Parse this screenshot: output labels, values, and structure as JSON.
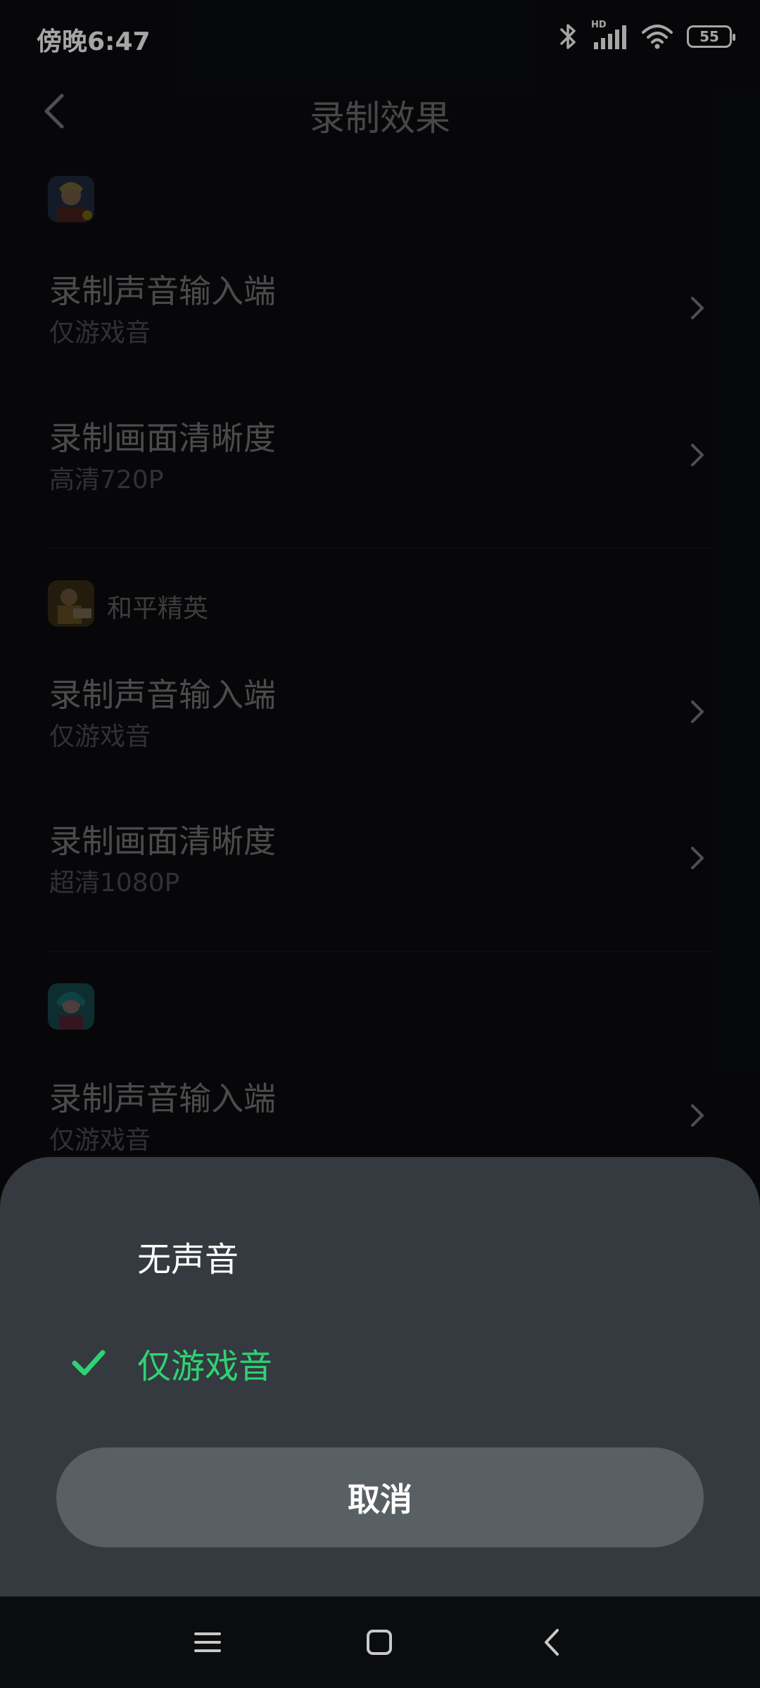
{
  "status_bar": {
    "time": "傍晚6:47",
    "network_label": "HD",
    "battery": "55"
  },
  "header": {
    "title": "录制效果"
  },
  "sections": [
    {
      "game_name": "",
      "icon": "game-icon-warrior",
      "rows": [
        {
          "title": "录制声音输入端",
          "value": "仅游戏音"
        },
        {
          "title": "录制画面清晰度",
          "value": "高清720P"
        }
      ]
    },
    {
      "game_name": "和平精英",
      "icon": "game-icon-peace-elite",
      "rows": [
        {
          "title": "录制声音输入端",
          "value": "仅游戏音"
        },
        {
          "title": "录制画面清晰度",
          "value": "超清1080P"
        }
      ]
    },
    {
      "game_name": "",
      "icon": "game-icon-teal-hero",
      "rows": [
        {
          "title": "录制声音输入端",
          "value": "仅游戏音"
        }
      ]
    }
  ],
  "sheet": {
    "options": [
      {
        "label": "无声音",
        "selected": false
      },
      {
        "label": "仅游戏音",
        "selected": true
      }
    ],
    "cancel_label": "取消"
  },
  "colors": {
    "accent": "#2fd274",
    "sheet_bg": "#343a3f",
    "button_bg": "#596063",
    "background": "#0b0c0e"
  },
  "nav_bar": {
    "icons": [
      "menu-icon",
      "home-icon",
      "back-icon"
    ]
  }
}
